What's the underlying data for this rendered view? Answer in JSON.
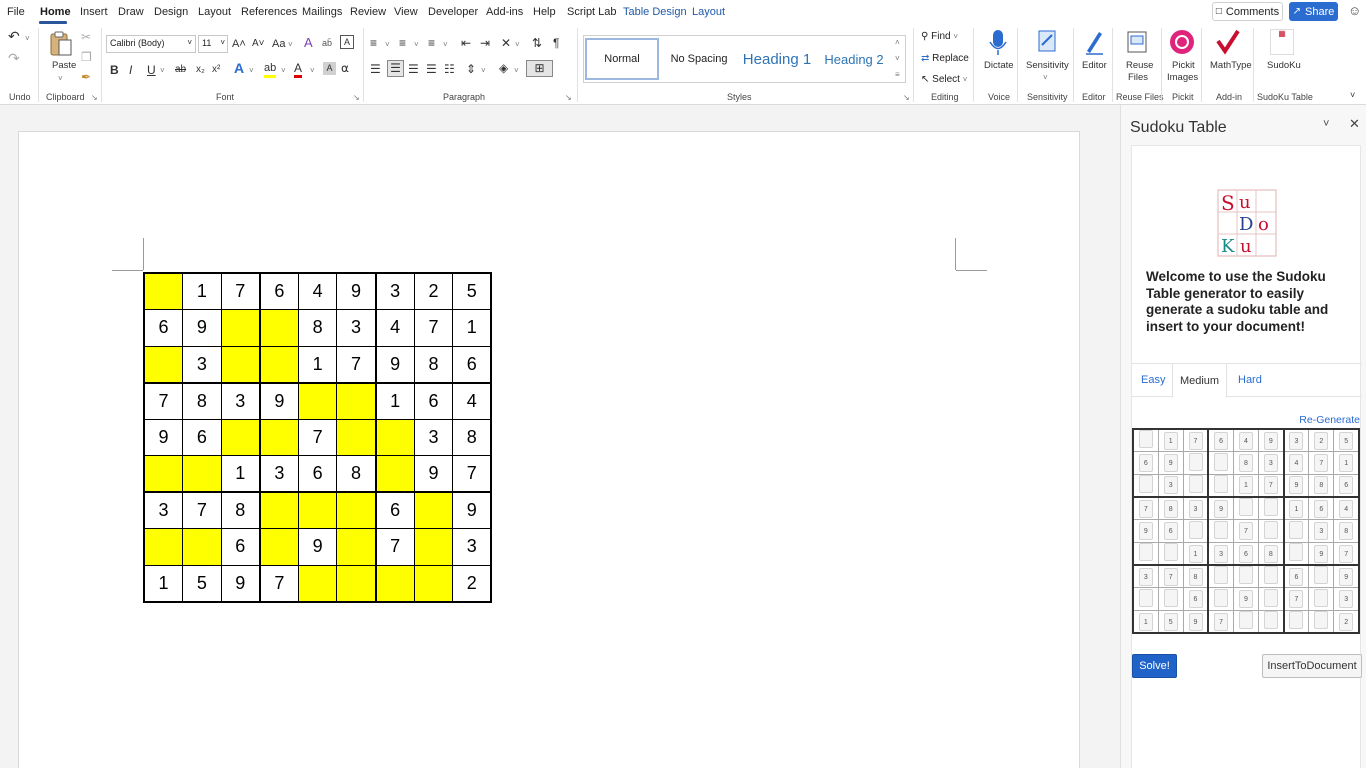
{
  "menu": {
    "tabs": [
      "File",
      "Home",
      "Insert",
      "Draw",
      "Design",
      "Layout",
      "References",
      "Mailings",
      "Review",
      "View",
      "Developer",
      "Add-ins",
      "Help",
      "Script Lab",
      "Table Design",
      "Layout"
    ],
    "active": "Home",
    "comments_label": "Comments",
    "share_label": "Share"
  },
  "ribbon": {
    "groups": {
      "undo": "Undo",
      "clipboard": "Clipboard",
      "font": "Font",
      "paragraph": "Paragraph",
      "styles": "Styles",
      "editing": "Editing",
      "voice": "Voice",
      "sensitivity": "Sensitivity",
      "editor": "Editor",
      "reuse_files": "Reuse Files",
      "pickit": "Pickit",
      "addin": "Add-in",
      "sudoku_table": "SudoKu Table"
    },
    "paste_label": "Paste",
    "font_name": "Calibri (Body)",
    "font_size": "11",
    "font_buttons": {
      "bold": "B",
      "italic": "I",
      "underline": "U",
      "strike": "ab",
      "sub": "x₂",
      "sup": "x²",
      "grow": "A˄",
      "shrink": "A˅",
      "case": "Aa",
      "effects": "A",
      "highlight": "ab",
      "color": "A",
      "shade": "A",
      "charborder": "A",
      "clear": "A"
    },
    "styles": [
      "Normal",
      "No Spacing",
      "Heading 1",
      "Heading 2"
    ],
    "editing": {
      "find": "Find",
      "replace": "Replace",
      "select": "Select"
    },
    "dictate_label": "Dictate",
    "sensitivity_label": "Sensitivity",
    "editor_label": "Editor",
    "reuse_line1": "Reuse",
    "reuse_line2": "Files",
    "pickit_line1": "Pickit",
    "pickit_line2": "Images",
    "mathtype_label": "MathType",
    "sudoku_label": "SudoKu",
    "colors": {
      "accent": "#2b579a",
      "highlight": "#ffff00",
      "font_color": "#e00000"
    }
  },
  "document": {
    "sudoku": [
      [
        "",
        "1",
        "7",
        "6",
        "4",
        "9",
        "3",
        "2",
        "5"
      ],
      [
        "6",
        "9",
        "",
        "",
        "8",
        "3",
        "4",
        "7",
        "1"
      ],
      [
        "",
        "3",
        "",
        "",
        "1",
        "7",
        "9",
        "8",
        "6"
      ],
      [
        "7",
        "8",
        "3",
        "9",
        "",
        "",
        "1",
        "6",
        "4"
      ],
      [
        "9",
        "6",
        "",
        "",
        "7",
        "",
        "",
        "3",
        "8"
      ],
      [
        "",
        "",
        "1",
        "3",
        "6",
        "8",
        "",
        "9",
        "7"
      ],
      [
        "3",
        "7",
        "8",
        "",
        "",
        "",
        "6",
        "",
        "9"
      ],
      [
        "",
        "",
        "6",
        "",
        "9",
        "",
        "7",
        "",
        "3"
      ],
      [
        "1",
        "5",
        "9",
        "7",
        "",
        "",
        "",
        "",
        "2"
      ]
    ],
    "blank_color": "#ffff00"
  },
  "pane": {
    "title": "Sudoku Table",
    "logo_letters": [
      "S",
      "u",
      "D",
      "o",
      "K",
      "u"
    ],
    "welcome": "Welcome to use the Sudoku Table generator to easily generate a sudoku table and insert to your document!",
    "tabs": [
      "Easy",
      "Medium",
      "Hard"
    ],
    "active_tab": "Medium",
    "regenerate": "Re-Generate",
    "solve_label": "Solve!",
    "insert_label": "InsertToDocument"
  }
}
